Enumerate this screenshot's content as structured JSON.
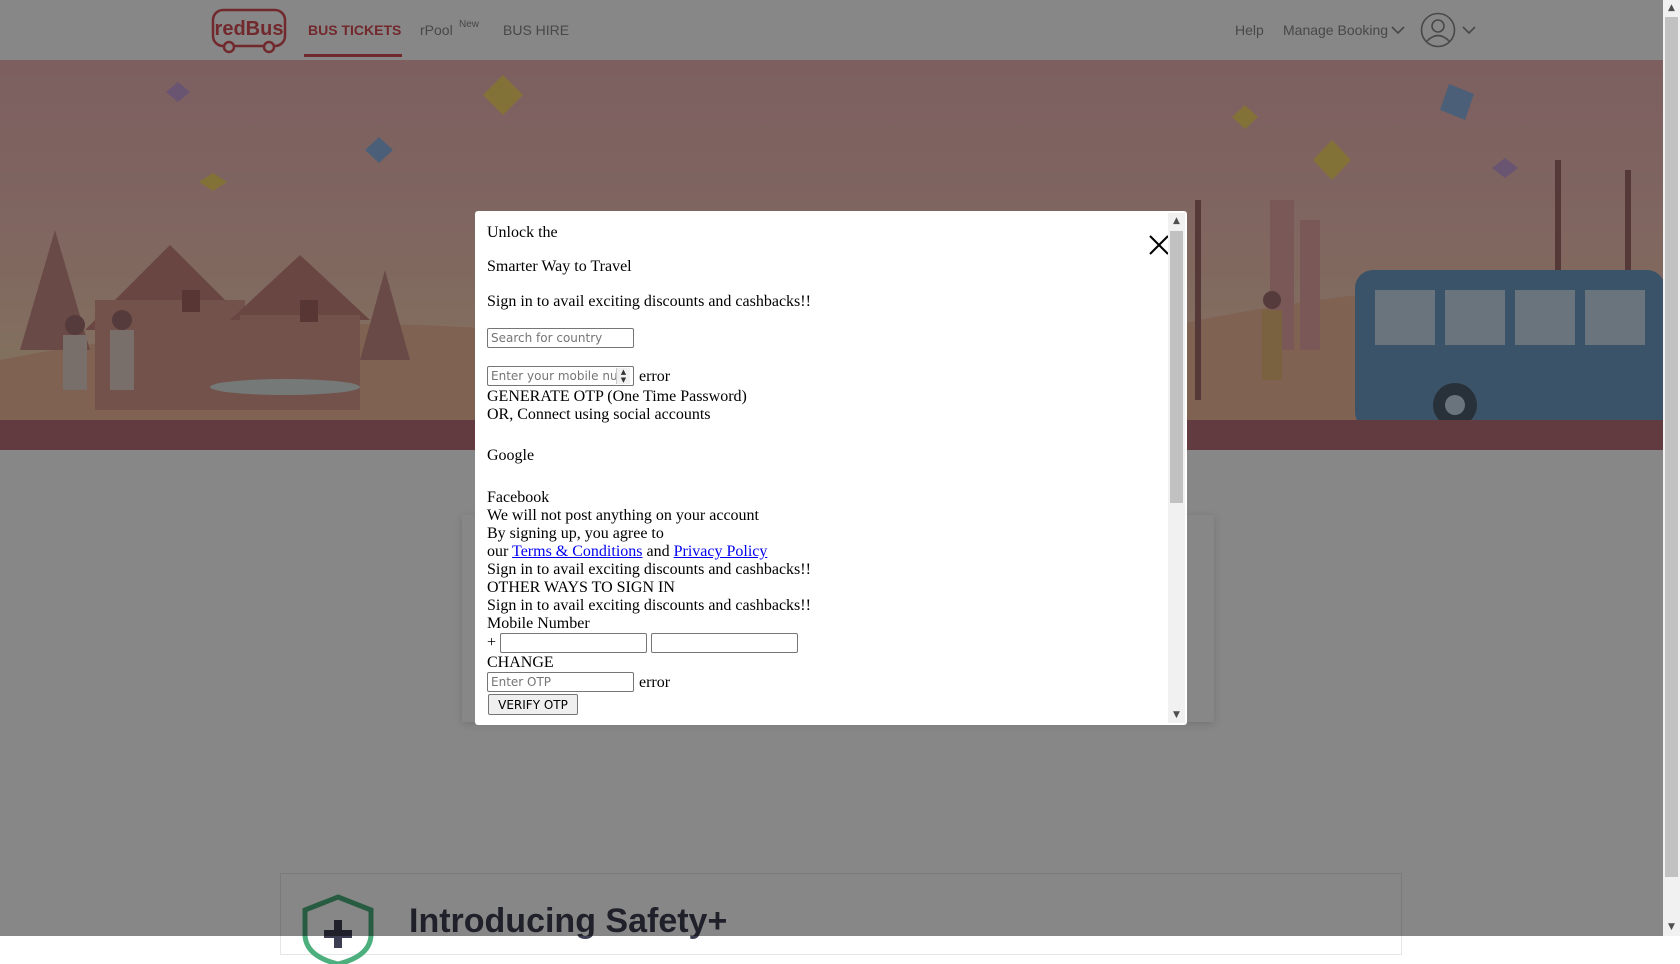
{
  "nav": {
    "logo_text": "redBus",
    "bus_tickets": "BUS TICKETS",
    "rpool": "rPool",
    "rpool_badge": "New",
    "bus_hire": "BUS HIRE",
    "help": "Help",
    "manage_booking": "Manage Booking"
  },
  "safety": {
    "title": "Introducing Safety+"
  },
  "modal": {
    "heading_line1": "Unlock the",
    "heading_line2": "Smarter Way to Travel",
    "subtitle": "Sign in to avail exciting discounts and cashbacks!!",
    "country_placeholder": "Search for country",
    "mobile_placeholder": "Enter your mobile number",
    "error_text": "error",
    "generate_otp": "GENERATE OTP (One Time Password)",
    "or_social": "OR, Connect using social accounts",
    "google": "Google",
    "facebook": "Facebook",
    "no_post_note": "We will not post anything on your account",
    "agree_text": "By signing up, you agree to",
    "our": "our",
    "terms": "Terms & Conditions",
    "and": "and",
    "privacy": "Privacy Policy",
    "subtitle_repeat1": "Sign in to avail exciting discounts and cashbacks!!",
    "other_ways": "OTHER WAYS TO SIGN IN",
    "subtitle_repeat2": "Sign in to avail exciting discounts and cashbacks!!",
    "mobile_number_label": "Mobile Number",
    "plus_sign": "+",
    "change": "CHANGE",
    "otp_placeholder": "Enter OTP",
    "otp_error": "error",
    "verify_otp": "VERIFY OTP"
  },
  "colors": {
    "brand": "#d84e55",
    "overlay": "rgba(0,0,0,0.47)",
    "link": "#0000ee"
  }
}
